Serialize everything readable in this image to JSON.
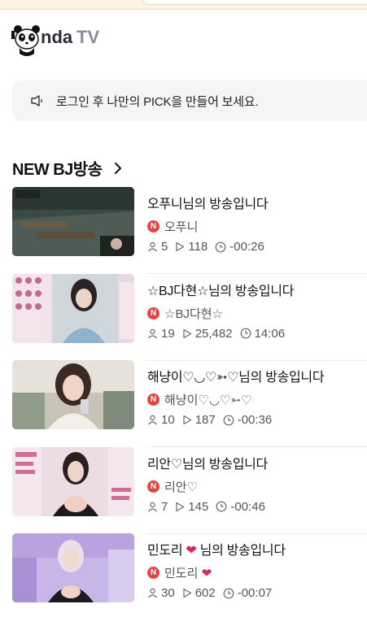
{
  "header": {
    "logo_text": "PandaTV",
    "logo_icon": "panda-logo-icon"
  },
  "notice": {
    "icon": "speaker-icon",
    "text": "로그인 후 나만의 PICK을 만들어 보세요."
  },
  "section": {
    "title": "NEW BJ방송",
    "more_icon": "chevron-right-icon"
  },
  "broadcasts": [
    {
      "title": "오푸니님의 방송입니다",
      "channel": "오푸니",
      "viewers": "5",
      "plays": "118",
      "time": "-00:26"
    },
    {
      "title": "☆BJ다현☆님의 방송입니다",
      "channel": "☆BJ다현☆",
      "viewers": "19",
      "plays": "25,482",
      "time": "14:06"
    },
    {
      "title": "해냥이♡◡♡➳♡님의 방송입니다",
      "channel": "해냥이♡◡♡➳♡",
      "viewers": "10",
      "plays": "187",
      "time": "-00:36"
    },
    {
      "title": "리안♡님의 방송입니다",
      "channel": "리안♡",
      "viewers": "7",
      "plays": "145",
      "time": "-00:46"
    },
    {
      "title": "민도리 ❤ 님의 방송입니다",
      "channel": "민도리 ❤",
      "viewers": "30",
      "plays": "602",
      "time": "-00:07"
    }
  ],
  "colors": {
    "badge": "#e8423f",
    "notice_bg": "#f5f5f7",
    "top_strip": "#fbf3e4",
    "heart": "#e0245e"
  }
}
